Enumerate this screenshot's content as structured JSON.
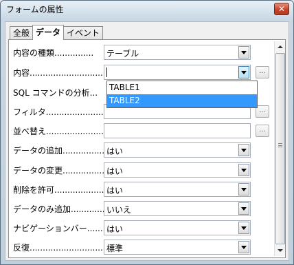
{
  "window": {
    "title": "フォームの属性",
    "close_glyph": "✕"
  },
  "tabs": [
    {
      "label": "全般",
      "active": false
    },
    {
      "label": "データ",
      "active": true
    },
    {
      "label": "イベント",
      "active": false
    }
  ],
  "rows": [
    {
      "label": "内容の種類...............",
      "value": "テーブル",
      "control": "select"
    },
    {
      "label": "内容...............................",
      "value": "",
      "control": "select-focused",
      "has_dots": true
    },
    {
      "label": "SQL コマンドの分析...",
      "value": "",
      "control": "hidden"
    },
    {
      "label": "フィルタ..........................",
      "value": "",
      "control": "text",
      "has_dots": true
    },
    {
      "label": "並べ替え...........................",
      "value": "",
      "control": "text",
      "has_dots": true
    },
    {
      "label": "データの追加.................",
      "value": "はい",
      "control": "select"
    },
    {
      "label": "データの変更.................",
      "value": "はい",
      "control": "select"
    },
    {
      "label": "削除を許可......................",
      "value": "はい",
      "control": "select"
    },
    {
      "label": "データのみ追加..............",
      "value": "いいえ",
      "control": "select"
    },
    {
      "label": "ナビゲーションバー........",
      "value": "はい",
      "control": "select"
    },
    {
      "label": "反復..................................",
      "value": "標準",
      "control": "select"
    }
  ],
  "dropdown": {
    "options": [
      "TABLE1",
      "TABLE2"
    ],
    "selected": "TABLE2"
  },
  "dots_label": "...",
  "colors": {
    "selection": "#3399ff",
    "close_button": "#c5442b"
  }
}
